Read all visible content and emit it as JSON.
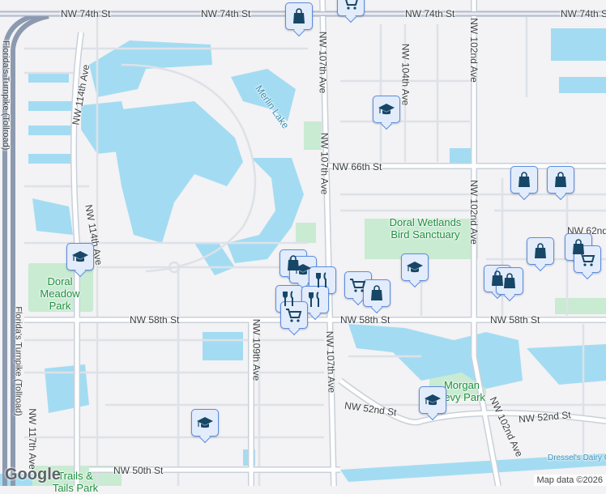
{
  "map": {
    "streets": {
      "nw74_left": "NW 74th St",
      "nw74_mid": "NW 74th St",
      "nw74_right": "NW 74th St",
      "nw107_top": "NW 107th Ave",
      "nw107_mid": "NW 107th Ave",
      "nw107_bottom": "NW 107th Ave",
      "nw104": "NW 104th Ave",
      "nw102_top": "NW 102nd Ave",
      "nw102_mid": "NW 102nd Ave",
      "nw102_bottom": "NW 102nd Ave",
      "nw114": "NW 114th Ave",
      "nw109": "NW 109th Ave",
      "nw117": "NW 117th Ave",
      "nw66": "NW 66th St",
      "nw62": "NW 62nd",
      "nw58_left": "NW 58th St",
      "nw58_mid": "NW 58th St",
      "nw58_right": "NW 58th St",
      "nw52_left": "NW 52nd St",
      "nw52_right": "NW 52nd St",
      "nw50": "NW 50th St",
      "turnpike_top": "Florida's Turnpike (Tollroad)",
      "turnpike_bottom": "Florida's Turnpike (Tollroad)"
    },
    "places": {
      "merlin_lake": "Merlin Lake",
      "doral_wetlands": "Doral Wetlands Bird Sanctuary",
      "doral_meadow": "Doral Meadow Park",
      "morgan_park": "Morgan Levy Park",
      "trails_park": "Trails & Tails Park",
      "dressel": "Dressel's Dairy C"
    },
    "attribution": "Map data ©2026",
    "logo": "Google",
    "colors": {
      "water": "#a3dcf2",
      "park": "#c8ebd2",
      "road": "#ffffff",
      "road_edge": "#c9d0da",
      "highway": "#8c9ab0",
      "pin_bg": "#e3ecfb",
      "pin_border": "#5b8de0",
      "icon": "#174766"
    }
  }
}
